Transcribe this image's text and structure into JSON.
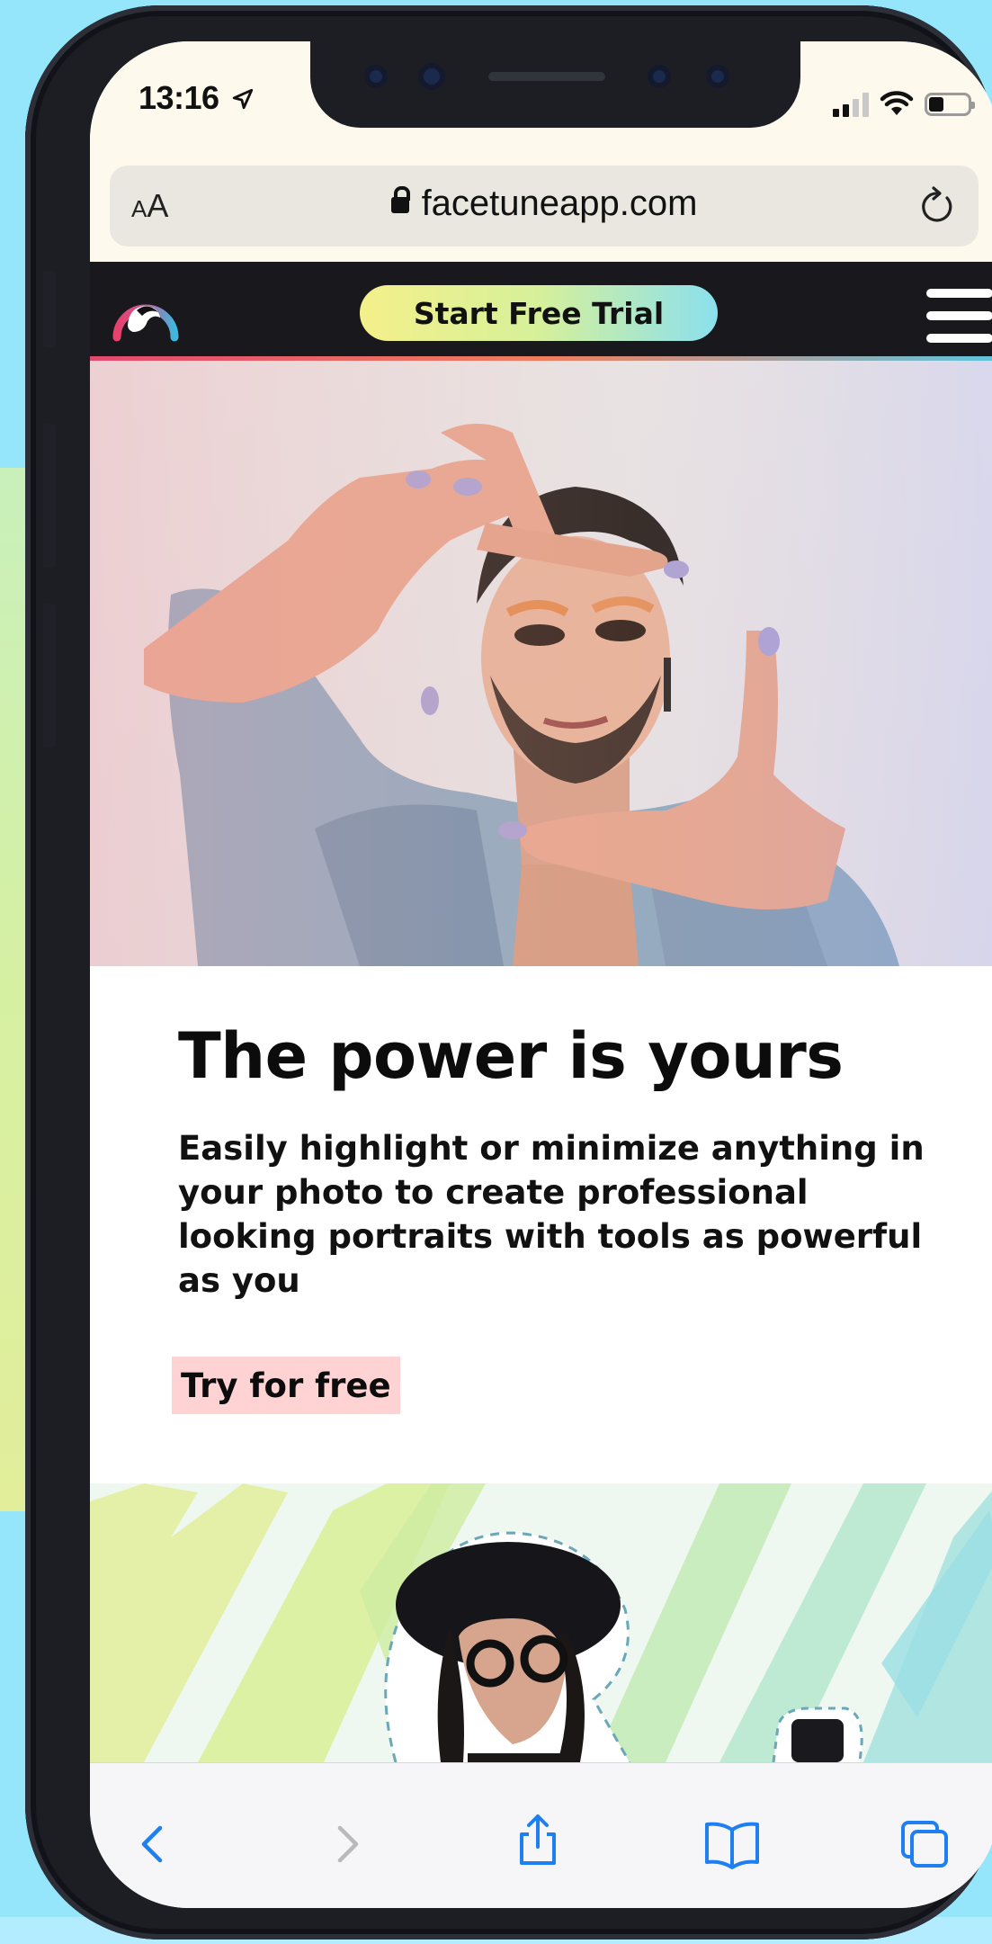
{
  "status_bar": {
    "time": "13:16"
  },
  "browser": {
    "text_size_label_small": "A",
    "text_size_label_big": "A",
    "url": "facetuneapp.com"
  },
  "site_header": {
    "cta_label": "Start Free Trial"
  },
  "hero": {
    "headline": "The power is yours",
    "body": "Easily highlight or minimize anything in your photo to create professional looking portraits with tools as powerful as you",
    "cta_label": "Try for free"
  },
  "colors": {
    "background": "#95e6fb",
    "header_bg": "#19191d",
    "trial_gradient": [
      "#f4f08a",
      "#d6f09a",
      "#8be0ee"
    ],
    "try_button_bg": "#ffd2d3",
    "toolbar_accent": "#1e7ff0"
  },
  "toolbar": {
    "icons": [
      "back-icon",
      "forward-icon",
      "share-icon",
      "bookmarks-icon",
      "tabs-icon"
    ]
  }
}
